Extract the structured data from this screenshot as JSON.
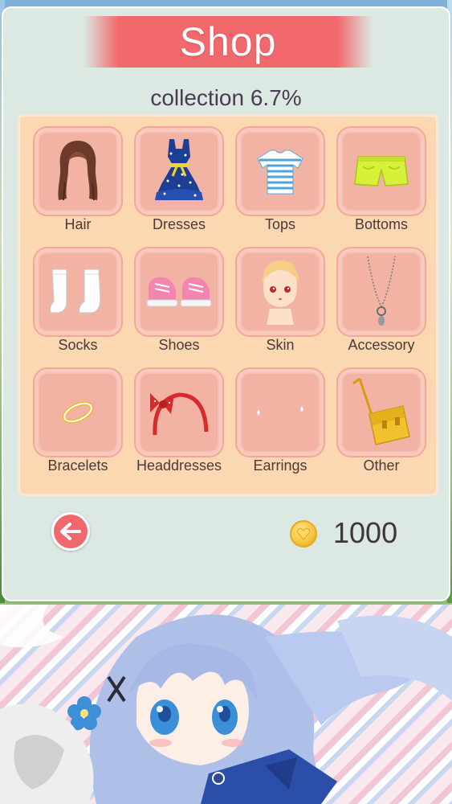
{
  "title": "Shop",
  "collection": {
    "label": "collection",
    "value": "6.7%"
  },
  "categories": [
    {
      "label": "Hair",
      "icon": "hair-icon"
    },
    {
      "label": "Dresses",
      "icon": "dress-icon"
    },
    {
      "label": "Tops",
      "icon": "top-icon"
    },
    {
      "label": "Bottoms",
      "icon": "shorts-icon"
    },
    {
      "label": "Socks",
      "icon": "socks-icon"
    },
    {
      "label": "Shoes",
      "icon": "shoes-icon"
    },
    {
      "label": "Skin",
      "icon": "skin-icon"
    },
    {
      "label": "Accessory",
      "icon": "necklace-icon"
    },
    {
      "label": "Bracelets",
      "icon": "bracelet-icon"
    },
    {
      "label": "Headdresses",
      "icon": "headband-icon"
    },
    {
      "label": "Earrings",
      "icon": "earrings-icon"
    },
    {
      "label": "Other",
      "icon": "bag-icon"
    }
  ],
  "footer": {
    "back_icon": "arrow-left-icon",
    "coin_icon": "coin-icon",
    "coins": "1000"
  },
  "colors": {
    "title_banner": "#f2696d",
    "panel": "#fcd8b2",
    "cell": "#f2b3a4",
    "dialog": "#dce9e3"
  }
}
